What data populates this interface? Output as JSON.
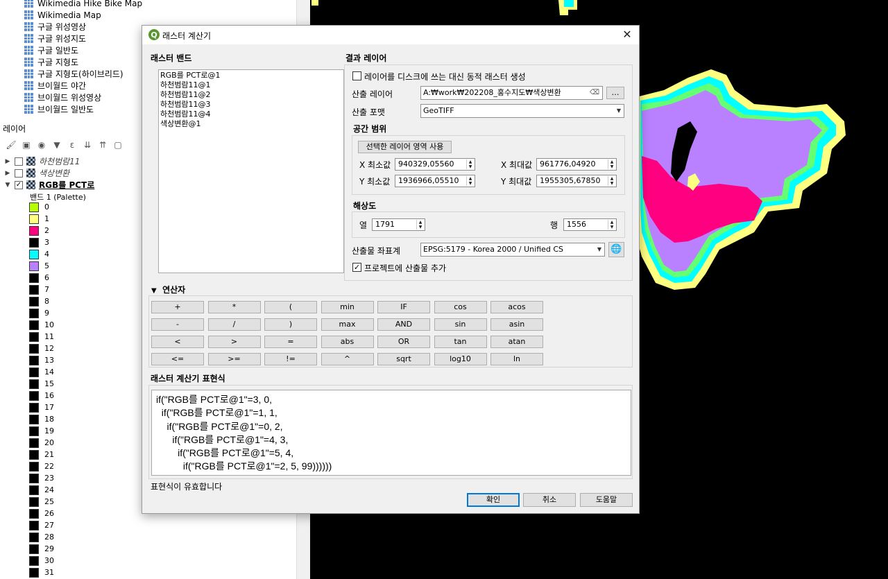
{
  "browser": {
    "items": [
      "Wikimedia Hike Bike Map",
      "Wikimedia Map",
      "구글 위성영상",
      "구글 위성지도",
      "구글 일반도",
      "구글 지형도",
      "구글 지형도(하이브리드)",
      "브이월드 야간",
      "브이월드 위성영상",
      "브이월드 일반도"
    ]
  },
  "layers_panel": {
    "title": "레이어",
    "layers": [
      {
        "name": "하천범람11",
        "checked": false
      },
      {
        "name": "색상변환",
        "checked": false
      },
      {
        "name": "RGB를 PCT로",
        "checked": true
      }
    ],
    "band_label": "밴드 1 (Palette)",
    "legend": [
      {
        "value": "0",
        "color": "#b8ff00"
      },
      {
        "value": "1",
        "color": "#ffff80"
      },
      {
        "value": "2",
        "color": "#ff0080"
      },
      {
        "value": "3",
        "color": "#000000"
      },
      {
        "value": "4",
        "color": "#00ffff"
      },
      {
        "value": "5",
        "color": "#b980ff"
      },
      {
        "value": "6",
        "color": "#000000"
      },
      {
        "value": "7",
        "color": "#000000"
      },
      {
        "value": "8",
        "color": "#000000"
      },
      {
        "value": "9",
        "color": "#000000"
      },
      {
        "value": "10",
        "color": "#000000"
      },
      {
        "value": "11",
        "color": "#000000"
      },
      {
        "value": "12",
        "color": "#000000"
      },
      {
        "value": "13",
        "color": "#000000"
      },
      {
        "value": "14",
        "color": "#000000"
      },
      {
        "value": "15",
        "color": "#000000"
      },
      {
        "value": "16",
        "color": "#000000"
      },
      {
        "value": "17",
        "color": "#000000"
      },
      {
        "value": "18",
        "color": "#000000"
      },
      {
        "value": "19",
        "color": "#000000"
      },
      {
        "value": "20",
        "color": "#000000"
      },
      {
        "value": "21",
        "color": "#000000"
      },
      {
        "value": "22",
        "color": "#000000"
      },
      {
        "value": "23",
        "color": "#000000"
      },
      {
        "value": "24",
        "color": "#000000"
      },
      {
        "value": "25",
        "color": "#000000"
      },
      {
        "value": "26",
        "color": "#000000"
      },
      {
        "value": "27",
        "color": "#000000"
      },
      {
        "value": "28",
        "color": "#000000"
      },
      {
        "value": "29",
        "color": "#000000"
      },
      {
        "value": "30",
        "color": "#000000"
      },
      {
        "value": "31",
        "color": "#000000"
      }
    ]
  },
  "dialog": {
    "title": "래스터 계산기",
    "raster_bands": {
      "label": "래스터 밴드",
      "items": [
        "RGB를 PCT로@1",
        "하천범람11@1",
        "하천범람11@2",
        "하천범람11@3",
        "하천범람11@4",
        "색상변환@1"
      ]
    },
    "result_layer": {
      "label": "결과 레이어",
      "virtual_label": "레이어를 디스크에 쓰는 대신 동적 래스터 생성",
      "virtual_checked": false,
      "output_layer_label": "산출 레이어",
      "output_layer_value": "A:₩work₩202208_홍수지도₩색상변환",
      "browse_label": "…",
      "output_format_label": "산출 포맷",
      "output_format_value": "GeoTIFF",
      "extent_label": "공간 범위",
      "use_extent_button": "선택한 레이어 영역 사용",
      "xmin_label": "X 최소값",
      "xmin_value": "940329,05560",
      "xmax_label": "X 최대값",
      "xmax_value": "961776,04920",
      "ymin_label": "Y 최소값",
      "ymin_value": "1936966,05510",
      "ymax_label": "Y 최대값",
      "ymax_value": "1955305,67850",
      "resolution_label": "해상도",
      "columns_label": "열",
      "columns_value": "1791",
      "rows_label": "행",
      "rows_value": "1556",
      "crs_label": "산출물 좌표계",
      "crs_value": "EPSG:5179 - Korea 2000 / Unified CS",
      "add_to_project_label": "프로젝트에 산출물 추가",
      "add_to_project_checked": true
    },
    "operators": {
      "label": "연산자",
      "rows": [
        [
          "+",
          "*",
          "(",
          "min",
          "IF",
          "cos",
          "acos"
        ],
        [
          "-",
          "/",
          ")",
          "max",
          "AND",
          "sin",
          "asin"
        ],
        [
          "<",
          ">",
          "=",
          "abs",
          "OR",
          "tan",
          "atan"
        ],
        [
          "<=",
          ">=",
          "!=",
          "^",
          "sqrt",
          "log10",
          "ln"
        ]
      ]
    },
    "expression": {
      "label": "래스터 계산기 표현식",
      "lines": [
        "if(\"RGB를 PCT로@1\"=3, 0,",
        "  if(\"RGB를 PCT로@1\"=1, 1,",
        "    if(\"RGB를 PCT로@1\"=0, 2,",
        "      if(\"RGB를 PCT로@1\"=4, 3,",
        "        if(\"RGB를 PCT로@1\"=5, 4,",
        "          if(\"RGB를 PCT로@1\"=2, 5, 99))))))"
      ],
      "status": "표현식이 유효합니다"
    },
    "buttons": {
      "ok": "확인",
      "cancel": "취소",
      "help": "도움말"
    }
  }
}
